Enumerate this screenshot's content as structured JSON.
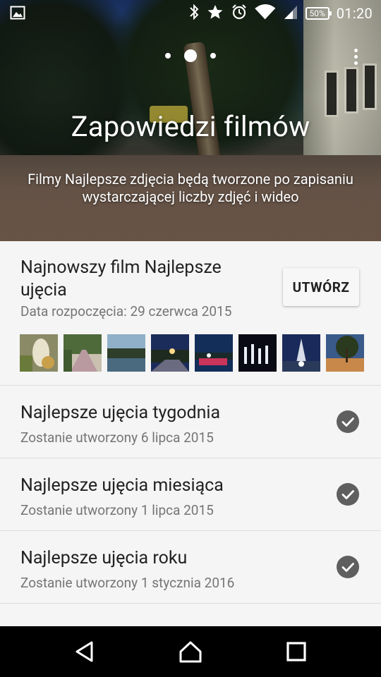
{
  "status_bar": {
    "time": "01:20",
    "battery_percent": "50%",
    "icons": [
      "gallery-notification-icon",
      "bluetooth-icon",
      "star-icon",
      "alarm-icon",
      "wifi-icon",
      "signal-icon",
      "battery-icon"
    ]
  },
  "header": {
    "title": "Zapowiedzi filmów",
    "subtitle": "Filmy Najlepsze zdjęcia będą tworzone po zapisaniu wystarczającej liczby zdjęć i wideo",
    "page_indicator": {
      "count": 3,
      "active_index": 1
    },
    "menu_icon": "more-vert-icon"
  },
  "latest_movie": {
    "title": "Najnowszy film Najlepsze ujęcia",
    "date_label": "Data rozpoczęcia: 29 czerwca 2015",
    "create_button_label": "UTWÓRZ",
    "thumbnail_count": 8
  },
  "scheduled": [
    {
      "title": "Najlepsze ujęcia tygodnia",
      "subtitle": "Zostanie utworzony 6 lipca 2015",
      "status_icon": "check-circle-icon"
    },
    {
      "title": "Najlepsze ujęcia miesiąca",
      "subtitle": "Zostanie utworzony 1 lipca 2015",
      "status_icon": "check-circle-icon"
    },
    {
      "title": "Najlepsze ujęcia roku",
      "subtitle": "Zostanie utworzony 1 stycznia 2016",
      "status_icon": "check-circle-icon"
    }
  ],
  "nav_bar": {
    "buttons": [
      "back-icon",
      "home-icon",
      "recents-icon"
    ]
  },
  "colors": {
    "primary_text": "#212121",
    "secondary_text": "#757575",
    "check_circle": "#5f5f5f",
    "background": "#f5f5f5",
    "nav_bar": "#000000"
  }
}
